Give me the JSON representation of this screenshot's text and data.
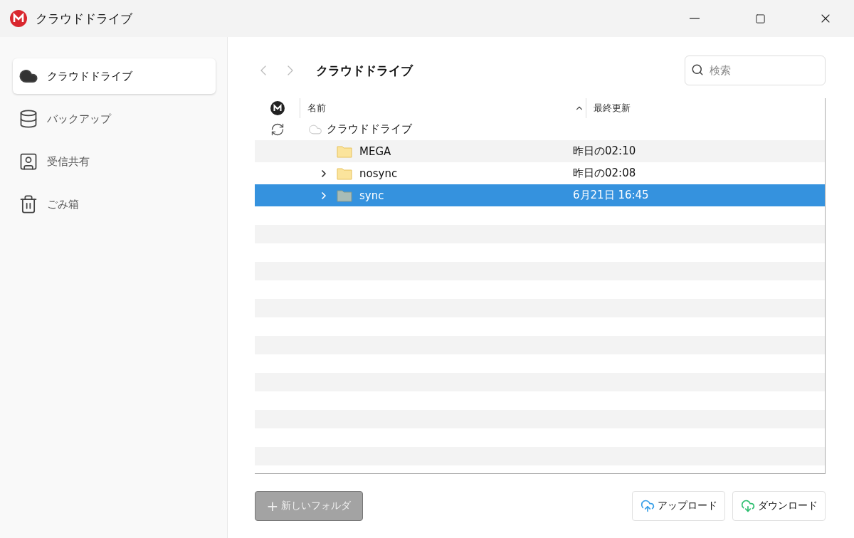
{
  "window": {
    "title": "クラウドドライブ"
  },
  "sidebar": {
    "items": [
      {
        "label": "クラウドドライブ",
        "selected": true
      },
      {
        "label": "バックアップ",
        "selected": false
      },
      {
        "label": "受信共有",
        "selected": false
      },
      {
        "label": "ごみ箱",
        "selected": false
      }
    ]
  },
  "breadcrumb": {
    "title": "クラウドドライブ"
  },
  "search": {
    "placeholder": "検索"
  },
  "table": {
    "columns": [
      "名前",
      "最終更新"
    ],
    "tree": {
      "label": "クラウドドライブ",
      "children": [
        {
          "label": "MEGA",
          "modified": "昨日の02:10",
          "has_children": false,
          "selected": false
        },
        {
          "label": "nosync",
          "modified": "昨日の02:08",
          "has_children": true,
          "selected": false
        },
        {
          "label": "sync",
          "modified": "6月21日 16:45",
          "has_children": true,
          "selected": true
        }
      ]
    }
  },
  "buttons": {
    "new_folder": {
      "label": "新しいフォルダ",
      "icon": "+",
      "disabled": true
    },
    "upload": {
      "label": "アップロード"
    },
    "download": {
      "label": "ダウンロード"
    }
  }
}
